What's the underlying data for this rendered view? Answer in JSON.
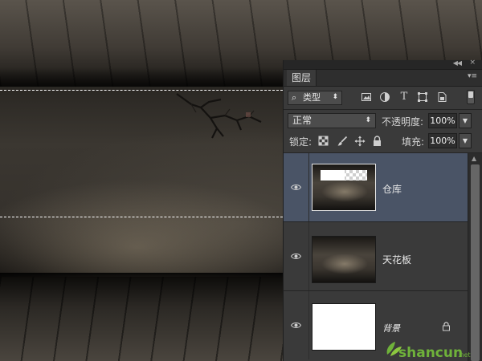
{
  "layers_panel": {
    "tab_label": "图层",
    "filter": {
      "label": "类型"
    },
    "blend_mode": "正常",
    "opacity_label": "不透明度:",
    "opacity_value": "100%",
    "lock_label": "锁定:",
    "fill_label": "填充:",
    "fill_value": "100%",
    "layers": [
      {
        "name": "仓库",
        "selected": true
      },
      {
        "name": "天花板",
        "selected": false
      },
      {
        "name": "背景",
        "selected": false,
        "locked": true
      }
    ]
  },
  "watermark": {
    "text": "shancun",
    "suffix": ".net"
  },
  "colors": {
    "selection_highlight": "#4a5466",
    "panel_bg": "#3a3a3a",
    "watermark_green": "#6fb23a"
  },
  "icons": [
    "search-icon",
    "image-filter-icon",
    "adjustment-filter-icon",
    "text-filter-icon",
    "shape-filter-icon",
    "smart-object-filter-icon",
    "eye-icon",
    "lock-icon",
    "move-icon",
    "brush-icon",
    "transparency-lock-icon",
    "panel-menu-icon"
  ]
}
